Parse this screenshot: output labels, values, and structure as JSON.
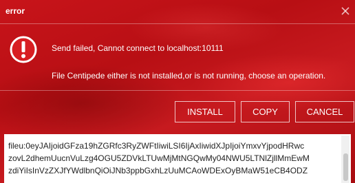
{
  "dialog": {
    "title": "error",
    "close_icon": "close-icon",
    "alert_icon": "exclamation-circle-icon",
    "message_primary": "Send failed, Cannot connect to localhost:10111",
    "message_secondary": "File Centipede either is not installed,or is not running, choose an operation.",
    "buttons": {
      "install": "INSTALL",
      "copy": "COPY",
      "cancel": "CANCEL"
    },
    "link_text": "fileu:0eyJAIjoidGFza19hZGRfc3RyZWFtIiwiLSI6IjAxIiwidXJpIjoiYmxvYjpodHRwc\nzovL2dhemUucnVuLzg4OGU5ZDVkLTUwMjMtNGQwMy04NWU5LTNlZjllMmEwM\nzdiYiIsInVzZXJfYWdlbnQiOiJNb3ppbGxhLzUuMCAoWDExOyBMaW51eCB4ODZ"
  },
  "colors": {
    "background": "#c0141a",
    "text": "#ffffff",
    "input_background": "#ffffff"
  }
}
